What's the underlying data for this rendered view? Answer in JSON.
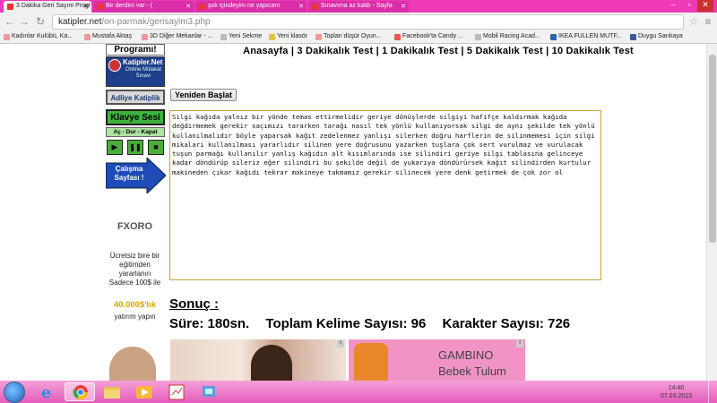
{
  "browser": {
    "tabs": [
      {
        "title": "3 Dakika Geri Sayım Progr",
        "active": true
      },
      {
        "title": "Bir derdim var - (",
        "active": false
      },
      {
        "title": "şok içindeyim ne yapıcam",
        "active": false
      },
      {
        "title": "Sınavıma az kaldı - Sayfa",
        "active": false
      }
    ],
    "url_domain": "katipler.net",
    "url_path": "/on-parmak/gerisayim3.php",
    "bookmarks": [
      "Kadınlar Kulübü, Ka...",
      "Mustafa Aktaş",
      "3D Diğer Mekanlar - ...",
      "Yeni Sekme",
      "Yeni klasör",
      "Toplan düşür Oyun...",
      "Facebook'ta Candy ...",
      "Mobil Racing Acad...",
      "IKEA FULLEN MUTF...",
      "Duygu Sarıkaya"
    ]
  },
  "sidebar": {
    "program_label": "Programı!",
    "katipler_logo": "Katipler.Net",
    "online_label": "Online Mülakat Sınavı",
    "adliye_button": "Adliye Katiplik",
    "klavye_sesi": "Klavye Sesi",
    "sound_controls": "Aç - Dur - Kapat",
    "calisma_button": "Çalışma Sayfası !",
    "ad_brand": "FXORO",
    "ad_text": "Ücretsiz bire bir eğitimden yararlanın Sadece 100$ ile",
    "ad_amount": "40.000$'lık",
    "ad_cta": "yatırım yapın"
  },
  "nav": {
    "links": [
      "Anasayfa",
      "3 Dakikalık Test",
      "1 Dakikalık Test",
      "5 Dakikalık Test",
      "10 Dakikalık Test"
    ]
  },
  "test": {
    "restart_button": "Yeniden Başlat",
    "typed_text": "Silgi kağıda yalnız bir yönde temas ettirmelidir geriye dönüşlerde silgiyi hafifçe kaldırmak kağıda değdirmemek gerekir saçımızı tararken tarağı nasıl tek yönlü kullanıyorsak silgi de aynı şekilde tek yönlü kullanılmalıdır böyle yaparsak kağıt zedelenmez yanlışı silerken doğru harflerin de silinmemesi için silgi mikaları kullanılması yararlıdır silinen yere doğrusunu yazarken tuşlara çok sert vurulmaz ve vurulacak tuşun parmağı kullanılır yanlış kağıdın alt kısımlarında ise silindiri geriye silgi tablasına gelinceye kadar döndürüp sileriz eğer silindiri bu şekilde değil de yukarıya döndürürsek kağıt silindirden kurtulur makineden çıkar kağıdı tekrar makineye takmamız gerekir silinecek yere denk getirmek de çok zor ol"
  },
  "results": {
    "heading": "Sonuç :",
    "sure": "Süre: 180sn.",
    "kelime": "Toplam Kelime Sayısı: 96",
    "karakter": "Karakter Sayısı: 726"
  },
  "ads": {
    "gambino_brand": "GAMBINO",
    "gambino_product": "Bebek Tulum"
  },
  "taskbar": {
    "time": "14:40",
    "date": "07.03.2013"
  }
}
